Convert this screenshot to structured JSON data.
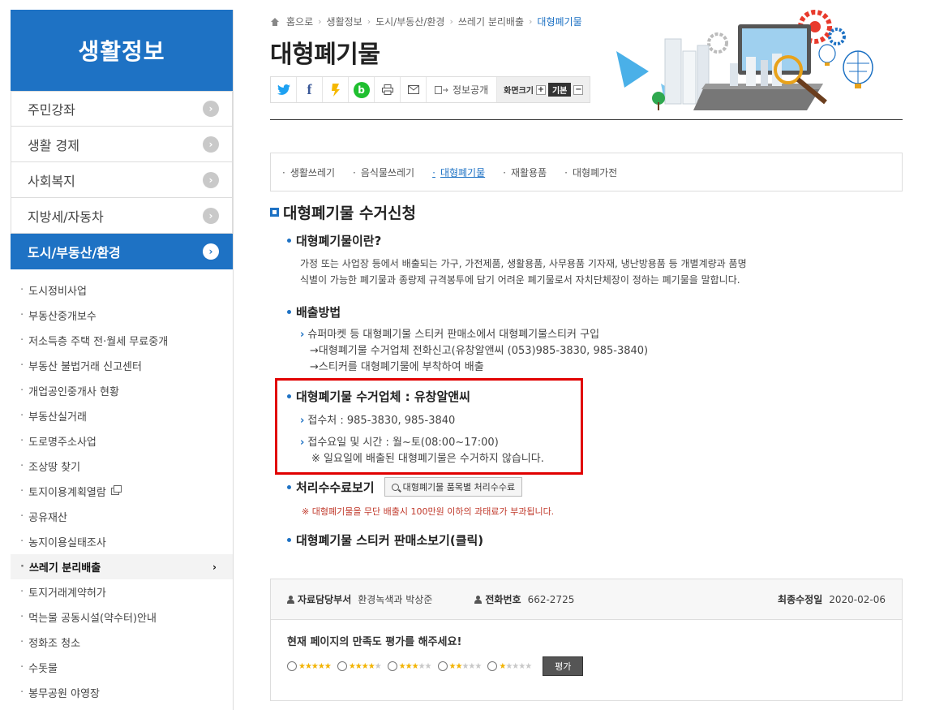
{
  "sidebar": {
    "title": "생활정보",
    "menu": [
      {
        "label": "주민강좌"
      },
      {
        "label": "생활 경제"
      },
      {
        "label": "사회복지"
      },
      {
        "label": "지방세/자동차"
      },
      {
        "label": "도시/부동산/환경"
      }
    ],
    "submenu": [
      "도시정비사업",
      "부동산중개보수",
      "저소득층 주택 전·월세 무료중개",
      "부동산 불법거래 신고센터",
      "개업공인중개사 현황",
      "부동산실거래",
      "도로명주소사업",
      "조상땅 찾기",
      "토지이용계획열람",
      "공유재산",
      "농지이용실태조사",
      "쓰레기 분리배출",
      "토지거래계약허가",
      "먹는물 공동시설(약수터)안내",
      "정화조 청소",
      "수돗물",
      "봉무공원 야영장"
    ]
  },
  "breadcrumb": [
    "홈으로",
    "생활정보",
    "도시/부동산/환경",
    "쓰레기 분리배출",
    "대형폐기물"
  ],
  "page_title": "대형폐기물",
  "toolbar": {
    "info_label": "정보공개",
    "zoom_label": "화면크기",
    "zoom_base": "기본",
    "plus": "+",
    "minus": "−"
  },
  "tabs": [
    "생활쓰레기",
    "음식물쓰레기",
    "대형폐기물",
    "재활용품",
    "대형폐가전"
  ],
  "section_title": "대형폐기물 수거신청",
  "content": {
    "what_title": "대형폐기물이란?",
    "what_line1": "가정 또는 사업장 등에서 배출되는 가구, 가전제품, 생활용품, 사무용품 기자재, 냉난방용품 등 개별계량과 품명",
    "what_line2": "식별이 가능한 폐기물과 종량제 규격봉투에 담기 어려운 폐기물로서 자치단체장이 정하는 폐기물을 말합니다.",
    "method_title": "배출방법",
    "method_line1": "슈퍼마켓 등 대형폐기물 스티커 판매소에서 대형폐기물스티커 구입",
    "method_line2": "→대형폐기물 수거업체 전화신고(유창알앤씨 (053)985-3830, 985-3840)",
    "method_line3": "→스티커를 대형폐기물에 부착하여 배출",
    "company_title": "대형폐기물 수거업체 : 유창알앤씨",
    "contact": "접수처 : 985-3830, 985-3840",
    "hours": "접수요일 및 시간 : 월~토(08:00~17:00)",
    "notice": "※ 일요일에 배출된 대형폐기물은 수거하지 않습니다.",
    "fee_title": "처리수수료보기",
    "fee_button": "대형폐기물 품목별 처리수수료",
    "warning": "※ 대형폐기물을 무단 배출시 100만원 이하의 과태료가 부과됩니다.",
    "sticker_title": "대형폐기물 스티커 판매소보기(클릭)"
  },
  "info": {
    "dept_label": "자료담당부서",
    "dept_value": "환경녹색과 박상준",
    "phone_label": "전화번호",
    "phone_value": "662-2725",
    "updated_label": "최종수정일",
    "updated_value": "2020-02-06",
    "rate_title": "현재 페이지의 만족도 평가를 해주세요!",
    "rate_button": "평가",
    "rate_levels": [
      5,
      4,
      3,
      2,
      1
    ]
  },
  "colors": {
    "brand": "#1e72c4",
    "highlight": "#e10000",
    "warning": "#c0392b"
  }
}
